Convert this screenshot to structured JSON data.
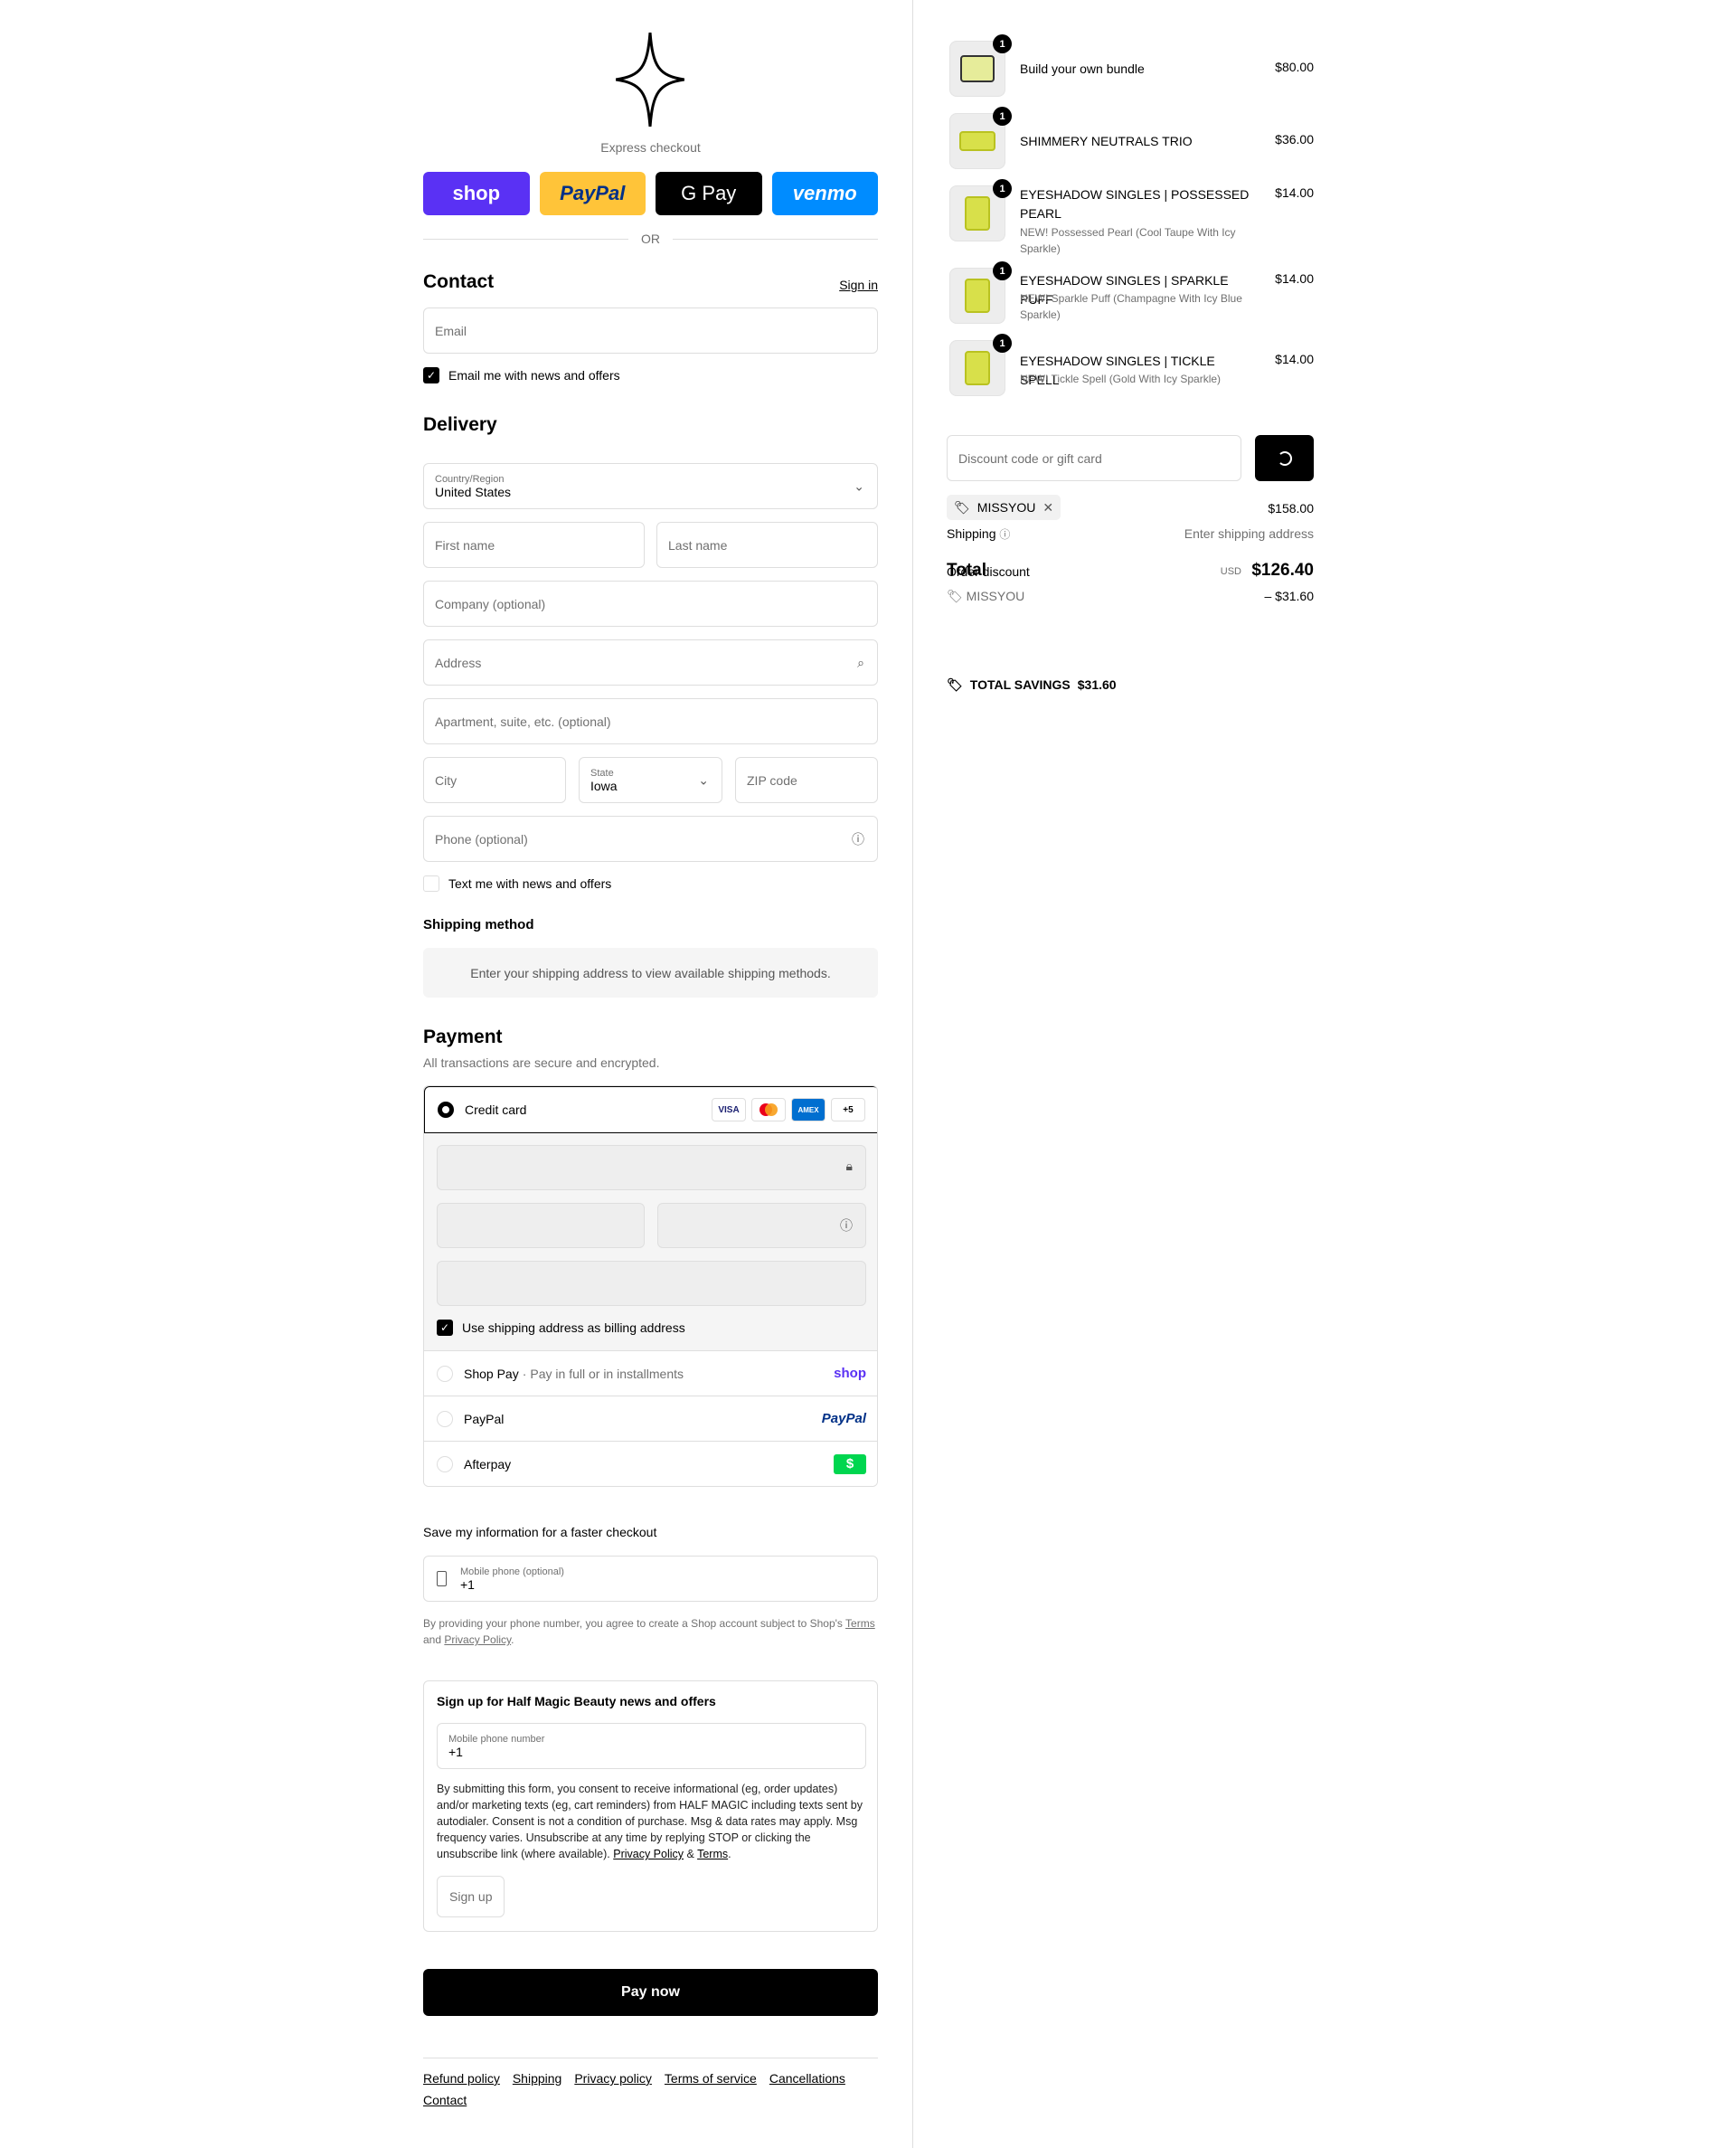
{
  "express": {
    "label": "Express checkout",
    "shop": "shop",
    "paypal": "PayPal",
    "gpay": "G Pay",
    "venmo": "venmo",
    "or": "OR"
  },
  "contact": {
    "title": "Contact",
    "sign_in": "Sign in",
    "email_placeholder": "Email",
    "email_news": "Email me with news and offers"
  },
  "delivery": {
    "title": "Delivery",
    "country_label": "Country/Region",
    "country_value": "United States",
    "first_name": "First name",
    "last_name": "Last name",
    "company": "Company (optional)",
    "address": "Address",
    "apartment": "Apartment, suite, etc. (optional)",
    "city": "City",
    "state_label": "State",
    "state_value": "Iowa",
    "zip": "ZIP code",
    "phone": "Phone (optional)",
    "text_news": "Text me with news and offers"
  },
  "shipping_method": {
    "title": "Shipping method",
    "message": "Enter your shipping address to view available shipping methods."
  },
  "payment": {
    "title": "Payment",
    "subtitle": "All transactions are secure and encrypted.",
    "credit_card": "Credit card",
    "cards": [
      "VISA",
      "MC",
      "AMEX",
      "+5"
    ],
    "billing_same": "Use shipping address as billing address",
    "shop_pay": "Shop Pay",
    "shop_pay_sub": "Pay in full or in installments",
    "shop_pay_logo": "shop",
    "paypal": "PayPal",
    "paypal_logo": "PayPal",
    "afterpay": "Afterpay",
    "afterpay_logo": "$"
  },
  "save_info": {
    "title": "Save my information for a faster checkout",
    "phone_label": "Mobile phone (optional)",
    "phone_value": "+1",
    "legal_prefix": "By providing your phone number, you agree to create a Shop account subject to Shop's ",
    "terms": "Terms",
    "and": " and ",
    "privacy": "Privacy Policy",
    "period": "."
  },
  "signup": {
    "title": "Sign up for Half Magic Beauty news and offers",
    "phone_label": "Mobile phone number",
    "phone_value": "+1",
    "consent": "By submitting this form, you consent to receive informational (eg, order updates) and/or marketing texts (eg, cart reminders) from HALF MAGIC including texts sent by autodialer. Consent is not a condition of purchase. Msg & data rates may apply. Msg frequency varies. Unsubscribe at any time by replying STOP or clicking the unsubscribe link (where available). ",
    "privacy": "Privacy Policy",
    "amp": " & ",
    "terms": "Terms",
    "period": ".",
    "button": "Sign up"
  },
  "pay_now": "Pay now",
  "footer": {
    "links": [
      "Refund policy",
      "Shipping",
      "Privacy policy",
      "Terms of service",
      "Cancellations",
      "Contact"
    ]
  },
  "cart": {
    "items": [
      {
        "name": "Build your own bundle",
        "sub": "",
        "price": "$80.00",
        "qty": "1"
      },
      {
        "name": "SHIMMERY NEUTRALS TRIO",
        "sub": "",
        "price": "$36.00",
        "qty": "1"
      },
      {
        "name": "EYESHADOW SINGLES | POSSESSED PEARL",
        "sub": "NEW! Possessed Pearl (Cool Taupe With Icy Sparkle)",
        "price": "$14.00",
        "qty": "1"
      },
      {
        "name": "EYESHADOW SINGLES | SPARKLE PUFF",
        "sub": "NEW! Sparkle Puff (Champagne With Icy Blue Sparkle)",
        "price": "$14.00",
        "qty": "1"
      },
      {
        "name": "EYESHADOW SINGLES | TICKLE SPELL",
        "sub": "NEW! Tickle Spell (Gold With Icy Sparkle)",
        "price": "$14.00",
        "qty": "1"
      }
    ],
    "discount_placeholder": "Discount code or gift card",
    "code": "MISSYOU",
    "subtotal_value": "$158.00",
    "shipping_label": "Shipping",
    "shipping_value": "Enter shipping address",
    "total_label": "Total",
    "order_discount_label": "Order discount",
    "currency": "USD",
    "total_value": "$126.40",
    "discount_code": "MISSYOU",
    "discount_value": "– $31.60",
    "savings_label": "TOTAL SAVINGS",
    "savings_value": "$31.60"
  }
}
